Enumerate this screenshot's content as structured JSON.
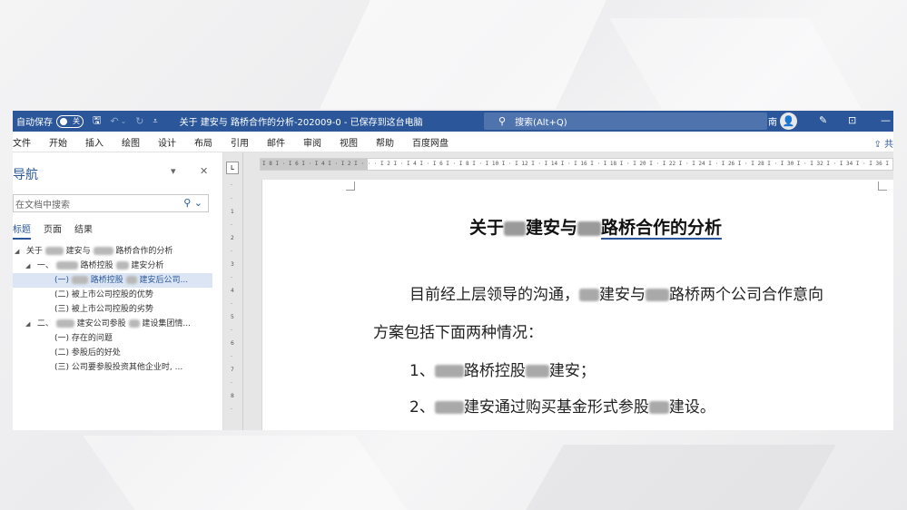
{
  "titlebar": {
    "autosave_label": "自动保存",
    "autosave_state": "关",
    "document_title": "关于 建安与 路桥合作的分析-202009-0 - 已保存到这台电脑",
    "search_placeholder": "搜索(Alt+Q)",
    "user_name": "南",
    "accent_color": "#2b579a"
  },
  "menu": [
    "文件",
    "开始",
    "插入",
    "绘图",
    "设计",
    "布局",
    "引用",
    "邮件",
    "审阅",
    "视图",
    "帮助",
    "百度网盘"
  ],
  "nav_pane": {
    "title": "导航",
    "search_placeholder": "在文档中搜索",
    "tabs": [
      "标题",
      "页面",
      "结果"
    ],
    "active_tab": "标题",
    "tree": [
      {
        "text_prefix": "关于",
        "text_mid": "建安与",
        "text_suffix": "路桥合作的分析",
        "level": 0,
        "expanded": true
      },
      {
        "text_prefix": "一、",
        "text_mid": "路桥控股",
        "text_suffix": "建安分析",
        "level": 1,
        "expanded": true
      },
      {
        "text_prefix": "(一)",
        "text_mid": "路桥控股",
        "text_suffix": "建安后公司...",
        "level": 2,
        "selected": true
      },
      {
        "text_prefix": "(二)",
        "text_mid": "",
        "text_suffix": "被上市公司控股的优势",
        "level": 2
      },
      {
        "text_prefix": "(三)",
        "text_mid": "",
        "text_suffix": "被上市公司控股的劣势",
        "level": 2
      },
      {
        "text_prefix": "二、",
        "text_mid": "建安公司参股",
        "text_suffix": "建设集团情...",
        "level": 1,
        "expanded": true
      },
      {
        "text_prefix": "(一)",
        "text_mid": "",
        "text_suffix": "存在的问题",
        "level": 2
      },
      {
        "text_prefix": "(二)",
        "text_mid": "",
        "text_suffix": "参股后的好处",
        "level": 2
      },
      {
        "text_prefix": "(三)",
        "text_mid": "",
        "text_suffix": "公司要参股投资其他企业时, ...",
        "level": 2
      }
    ]
  },
  "document": {
    "heading_prefix": "关于",
    "heading_mid": "建安与",
    "heading_suffix": "路桥合作的分析",
    "para1_prefix": "目前经上层领导的沟通，",
    "para1_mid": "建安与",
    "para1_suffix": "路桥两个公司合作意向",
    "para2": "方案包括下面两种情况：",
    "item1_prefix": "1、",
    "item1_mid": "路桥控股",
    "item1_suffix": "建安；",
    "item2_prefix": "2、",
    "item2_mid": "建安通过购买基金形式参股",
    "item2_suffix": "建设。"
  }
}
